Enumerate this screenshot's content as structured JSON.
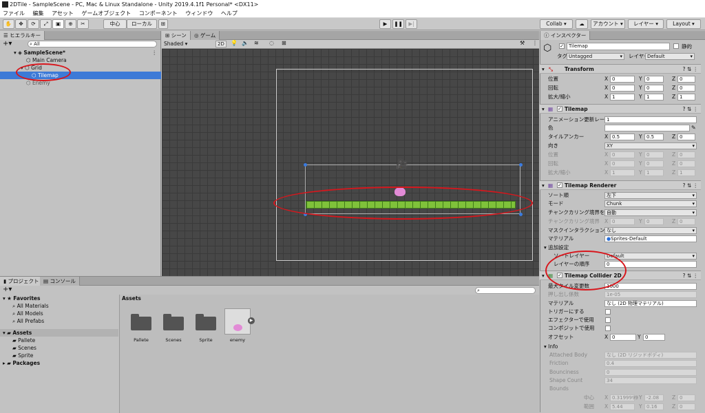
{
  "window": {
    "title": "2DTile - SampleScene - PC, Mac & Linux Standalone - Unity 2019.4.1f1 Personal* <DX11>"
  },
  "menu": [
    "ファイル",
    "編集",
    "アセット",
    "ゲームオブジェクト",
    "コンポーネント",
    "ウィンドウ",
    "ヘルプ"
  ],
  "toolbar": {
    "pivot": "中心",
    "space": "ローカル",
    "collab": "Collab",
    "account": "アカウント",
    "layers": "レイヤー",
    "layout": "Layout"
  },
  "hierarchy": {
    "tab": "ヒエラルキー",
    "search": "All",
    "scene": "SampleScene*",
    "items": [
      "Main Camera",
      "Grid",
      "Tilemap",
      "Enemy"
    ]
  },
  "scene": {
    "tab_scene": "シーン",
    "tab_game": "ゲーム",
    "shading": "Shaded",
    "mode2d": "2D",
    "gizmo_count": "0"
  },
  "project": {
    "tab_project": "プロジェクト",
    "tab_console": "コンソール",
    "favorites": "Favorites",
    "fav_items": [
      "All Materials",
      "All Models",
      "All Prefabs"
    ],
    "assets": "Assets",
    "asset_folders": [
      "Pallete",
      "Scenes",
      "Sprite"
    ],
    "packages": "Packages",
    "breadcrumb": "Assets",
    "grid_items": [
      "Pallete",
      "Scenes",
      "Sprite",
      "enemy"
    ]
  },
  "inspector": {
    "tab": "インスペクター",
    "name": "Tilemap",
    "static": "静的",
    "tag_label": "タグ",
    "tag": "Untagged",
    "layer_label": "レイヤー",
    "layer": "Default",
    "transform": {
      "title": "Transform",
      "pos": "位置",
      "rot": "回転",
      "scale": "拡大/縮小",
      "x": "X",
      "y": "Y",
      "z": "Z",
      "pos_v": [
        "0",
        "0",
        "0"
      ],
      "rot_v": [
        "0",
        "0",
        "0"
      ],
      "scale_v": [
        "1",
        "1",
        "1"
      ]
    },
    "tilemap": {
      "title": "Tilemap",
      "anim_label": "アニメーション更新レート",
      "anim": "1",
      "color_label": "色",
      "anchor_label": "タイルアンカー",
      "anchor": [
        "0.5",
        "0.5",
        "0"
      ],
      "orient_label": "向き",
      "orient": "XY",
      "pos": "位置",
      "rot": "回転",
      "scale": "拡大/縮小",
      "pos_v": [
        "0",
        "0",
        "0"
      ],
      "rot_v": [
        "0",
        "0",
        "0"
      ],
      "scale_v": [
        "1",
        "1",
        "1"
      ]
    },
    "renderer": {
      "title": "Tilemap Renderer",
      "sort_label": "ソート順",
      "sort": "左下",
      "mode_label": "モード",
      "mode": "Chunk",
      "detect_label": "チャンクカリング境界を検出",
      "detect": "自動",
      "bounds_label": "チャンクカリング境界",
      "bounds": [
        "0",
        "0",
        "0"
      ],
      "mask_label": "マスクインタラクション",
      "mask": "なし",
      "mat_label": "マテリアル",
      "mat": "Sprites-Default",
      "extra": "追加設定",
      "sortlayer_label": "ソートレイヤー",
      "sortlayer": "Default",
      "order_label": "レイヤーの順序",
      "order": "0"
    },
    "collider": {
      "title": "Tilemap Collider 2D",
      "maxtile_label": "最大タイル変更数",
      "maxtile": "1000",
      "extrusion_label": "押し出し係数",
      "extrusion": "1e-05",
      "mat_label": "マテリアル",
      "mat": "なし (2D 物理マテリアル)",
      "trigger": "トリガーにする",
      "effector": "エフェクターで使用",
      "composite": "コンポジットで使用",
      "offset_label": "オフセット",
      "offset": [
        "0",
        "0"
      ],
      "info": "Info",
      "attached_label": "Attached Body",
      "attached": "なし (2D リジッドボディ)",
      "friction_label": "Friction",
      "friction": "0.4",
      "bounce_label": "Bounciness",
      "bounce": "0",
      "shape_label": "Shape Count",
      "shape": "34",
      "bounds_label": "Bounds",
      "center_label": "中心",
      "center": [
        "0.3199999",
        "-2.08",
        "0"
      ],
      "extent_label": "範囲",
      "extent": [
        "5.44",
        "0.16",
        "0"
      ]
    }
  }
}
